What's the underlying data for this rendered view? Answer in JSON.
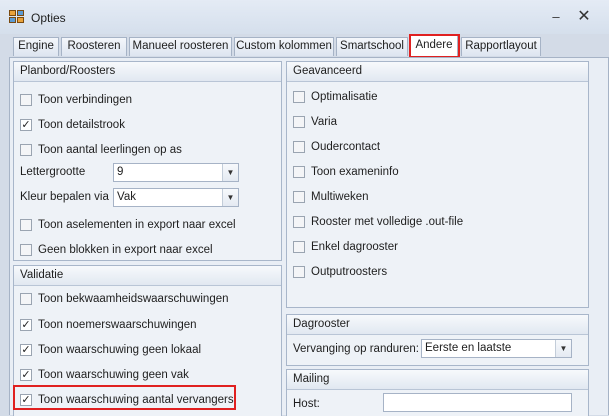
{
  "window": {
    "title": "Opties",
    "minimize": "–",
    "close": "✕"
  },
  "tabs": [
    {
      "label": "Engine"
    },
    {
      "label": "Roosteren"
    },
    {
      "label": "Manueel roosteren"
    },
    {
      "label": "Custom kolommen"
    },
    {
      "label": "Smartschool"
    },
    {
      "label": "Andere",
      "active": true
    },
    {
      "label": "Rapportlayout"
    }
  ],
  "planbord": {
    "header": "Planbord/Roosters",
    "checks": [
      {
        "label": "Toon verbindingen",
        "checked": false
      },
      {
        "label": "Toon detailstrook",
        "checked": true
      },
      {
        "label": "Toon aantal leerlingen op as",
        "checked": false
      }
    ],
    "lettergrootte": {
      "label": "Lettergrootte",
      "value": "9"
    },
    "kleur": {
      "label": "Kleur bepalen via",
      "value": "Vak"
    },
    "checks2": [
      {
        "label": "Toon aselementen in export naar excel",
        "checked": false
      },
      {
        "label": "Geen blokken in export naar excel",
        "checked": false
      }
    ]
  },
  "validatie": {
    "header": "Validatie",
    "checks": [
      {
        "label": "Toon bekwaamheidswaarschuwingen",
        "checked": false
      },
      {
        "label": "Toon noemerswaarschuwingen",
        "checked": true
      },
      {
        "label": "Toon waarschuwing geen lokaal",
        "checked": true
      },
      {
        "label": "Toon waarschuwing geen vak",
        "checked": true
      },
      {
        "label": "Toon waarschuwing aantal vervangers",
        "checked": true
      }
    ]
  },
  "geavanceerd": {
    "header": "Geavanceerd",
    "checks": [
      {
        "label": "Optimalisatie",
        "checked": false
      },
      {
        "label": "Varia",
        "checked": false
      },
      {
        "label": "Oudercontact",
        "checked": false
      },
      {
        "label": "Toon exameninfo",
        "checked": false
      },
      {
        "label": "Multiweken",
        "checked": false
      },
      {
        "label": "Rooster met volledige .out-file",
        "checked": false
      },
      {
        "label": "Enkel dagrooster",
        "checked": false
      },
      {
        "label": "Outputroosters",
        "checked": false
      }
    ]
  },
  "dagrooster": {
    "header": "Dagrooster",
    "vervanging": {
      "label": "Vervanging op randuren:",
      "value": "Eerste en laatste"
    }
  },
  "mailing": {
    "header": "Mailing",
    "host": {
      "label": "Host:",
      "value": ""
    }
  },
  "glyphs": {
    "check": "✓",
    "dropdown": "▼"
  }
}
